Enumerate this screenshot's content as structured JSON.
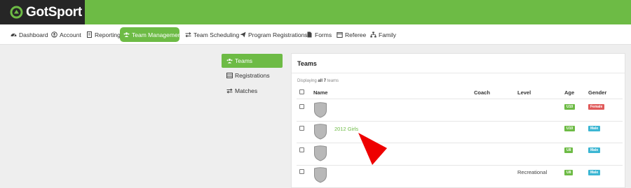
{
  "brand": {
    "name": "GotSport"
  },
  "nav": [
    {
      "label": "Dashboard",
      "icon": "dashboard-icon"
    },
    {
      "label": "Account",
      "icon": "user-circle-icon"
    },
    {
      "label": "Reporting",
      "icon": "document-icon"
    },
    {
      "label": "Team Management",
      "icon": "users-icon",
      "active": true
    },
    {
      "label": "Team Scheduling",
      "icon": "exchange-icon"
    },
    {
      "label": "Program Registrations",
      "icon": "paper-plane-icon"
    },
    {
      "label": "Forms",
      "icon": "file-icon"
    },
    {
      "label": "Referee",
      "icon": "calendar-icon"
    },
    {
      "label": "Family",
      "icon": "sitemap-icon"
    }
  ],
  "sidebar": [
    {
      "label": "Teams",
      "icon": "users-icon",
      "active": true
    },
    {
      "label": "Registrations",
      "icon": "table-icon"
    },
    {
      "label": "Matches",
      "icon": "exchange-icon"
    }
  ],
  "panel": {
    "title": "Teams",
    "displaying_prefix": "Displaying",
    "displaying_strong": "all 7",
    "displaying_suffix": "teams",
    "columns": {
      "name": "Name",
      "coach": "Coach",
      "level": "Level",
      "age": "Age",
      "gender": "Gender"
    }
  },
  "teams": [
    {
      "name": "",
      "coach": "",
      "level": "",
      "age": "U10",
      "gender": "Female"
    },
    {
      "name": "2012 Girls",
      "coach": "",
      "level": "",
      "age": "U10",
      "gender": "Male"
    },
    {
      "name": "",
      "coach": "",
      "level": "",
      "age": "U8",
      "gender": "Male"
    },
    {
      "name": "",
      "coach": "",
      "level": "Recreational",
      "age": "U8",
      "gender": "Male"
    }
  ],
  "colors": {
    "accent": "#6dbb45",
    "female": "#e05a5a",
    "male": "#3cb6d3",
    "annotation_arrow": "#ee0000"
  }
}
